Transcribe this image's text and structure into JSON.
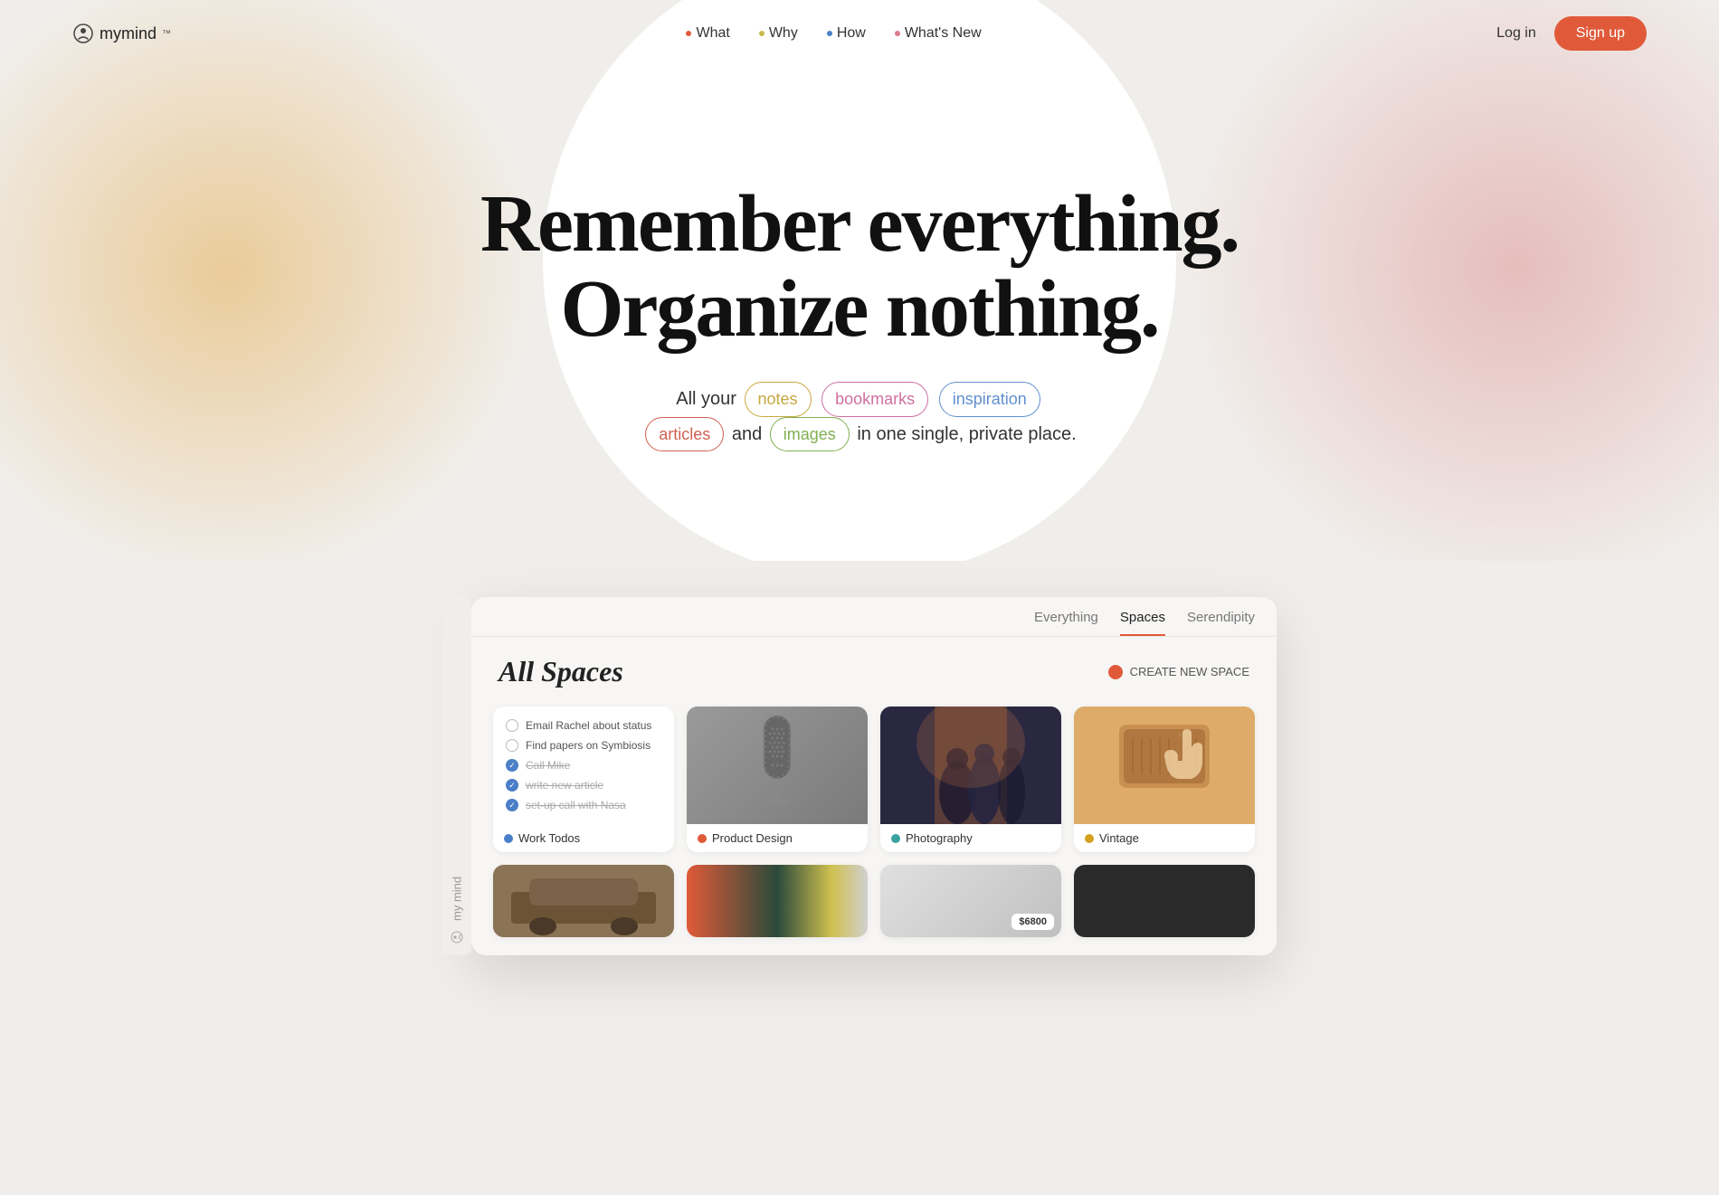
{
  "nav": {
    "logo": "mymind",
    "logo_tm": "™",
    "links": [
      {
        "label": "What",
        "dot_class": "dot-red"
      },
      {
        "label": "Why",
        "dot_class": "dot-yellow"
      },
      {
        "label": "How",
        "dot_class": "dot-blue"
      },
      {
        "label": "What's New",
        "dot_class": "dot-pink"
      }
    ],
    "login_label": "Log in",
    "signup_label": "Sign up"
  },
  "hero": {
    "headline_line1": "Remember everything.",
    "headline_line2": "Organize nothing.",
    "subtext_prefix": "All your",
    "pills": [
      {
        "label": "notes",
        "class": "pill-yellow"
      },
      {
        "label": "bookmarks",
        "class": "pill-pink"
      },
      {
        "label": "inspiration",
        "class": "pill-blue"
      }
    ],
    "subtext_middle": "and",
    "pills2": [
      {
        "label": "articles",
        "class": "pill-red"
      },
      {
        "label": "images",
        "class": "pill-green"
      }
    ],
    "subtext_suffix": "in one single, private place."
  },
  "app": {
    "tabs": [
      {
        "label": "Everything",
        "active": false
      },
      {
        "label": "Spaces",
        "active": true
      },
      {
        "label": "Serendipity",
        "active": false
      }
    ],
    "title": "All Spaces",
    "create_space_label": "CREATE NEW SPACE",
    "spaces": [
      {
        "type": "todo",
        "label": "Work Todos",
        "dot_class": "dot-blue-card",
        "todos": [
          {
            "text": "Email Rachel about status",
            "done": false
          },
          {
            "text": "Find papers on Symbiosis",
            "done": false
          },
          {
            "text": "Call Mike",
            "done": true
          },
          {
            "text": "write new article",
            "done": true
          },
          {
            "text": "set-up call with Nasa",
            "done": true
          }
        ]
      },
      {
        "type": "image",
        "label": "Product Design",
        "dot_class": "dot-red-card",
        "img_type": "microphone"
      },
      {
        "type": "image",
        "label": "Photography",
        "dot_class": "dot-teal-card",
        "img_type": "people"
      },
      {
        "type": "image",
        "label": "Vintage",
        "dot_class": "dot-yellow-card",
        "img_type": "vintage"
      }
    ],
    "spaces_row2": [
      {
        "type": "car"
      },
      {
        "type": "colorblock"
      },
      {
        "type": "price",
        "price": "$6800"
      },
      {
        "type": "dark"
      }
    ]
  },
  "sidebar": {
    "label": "my mind"
  }
}
